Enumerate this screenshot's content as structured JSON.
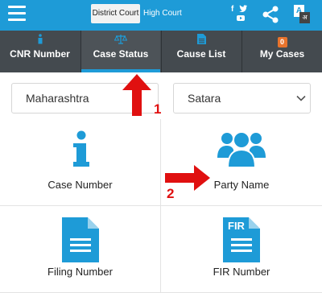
{
  "header": {
    "court_toggle": {
      "district": "District Court",
      "high": "High Court"
    },
    "social_icons": [
      "facebook-icon",
      "twitter-icon",
      "youtube-icon"
    ],
    "translate_glyphs": {
      "primary": "A",
      "secondary": "अ"
    },
    "colors": {
      "bar": "#1e9bd7"
    }
  },
  "tabs": [
    {
      "label": "CNR Number",
      "icon": "info-icon",
      "active": false
    },
    {
      "label": "Case Status",
      "icon": "scales-icon",
      "active": true
    },
    {
      "label": "Cause List",
      "icon": "document-icon",
      "active": false
    },
    {
      "label": "My Cases",
      "icon": "count-badge",
      "badge": "0",
      "active": false
    }
  ],
  "filters": {
    "state": "Maharashtra",
    "district": "Satara"
  },
  "options": [
    {
      "label": "Case Number",
      "icon": "info-icon"
    },
    {
      "label": "Party Name",
      "icon": "users-icon"
    },
    {
      "label": "Filing Number",
      "icon": "document-icon"
    },
    {
      "label": "FIR Number",
      "icon": "fir-document-icon",
      "icon_text": "FIR"
    }
  ],
  "annotations": [
    {
      "number": "1",
      "points_to": "Case Status",
      "color": "#e01010"
    },
    {
      "number": "2",
      "points_to": "Party Name",
      "color": "#e01010"
    }
  ],
  "accent_color": "#1e9bd7"
}
